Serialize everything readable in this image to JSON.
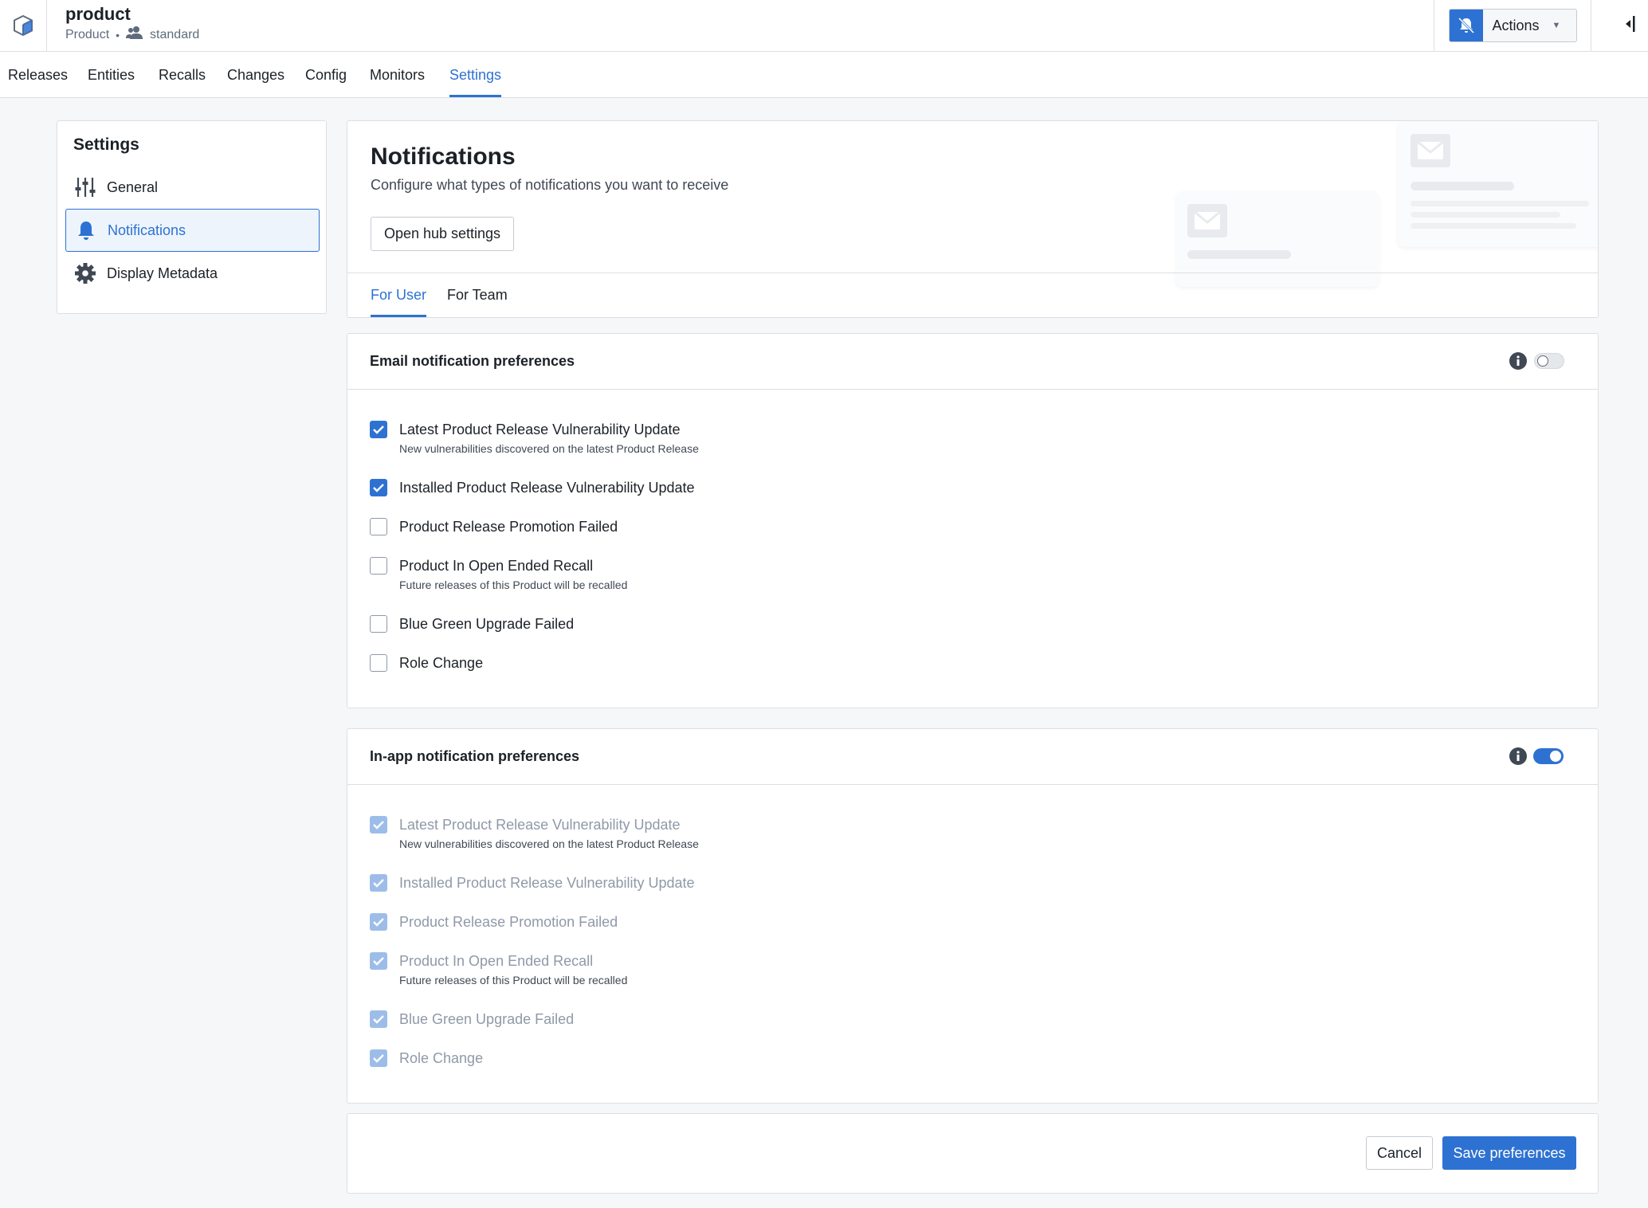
{
  "header": {
    "title": "product",
    "type_label": "Product",
    "separator": "•",
    "role_label": "standard",
    "actions_label": "Actions"
  },
  "tabs": [
    {
      "label": "Releases"
    },
    {
      "label": "Entities"
    },
    {
      "label": "Recalls"
    },
    {
      "label": "Changes"
    },
    {
      "label": "Config"
    },
    {
      "label": "Monitors"
    },
    {
      "label": "Settings",
      "active": true
    }
  ],
  "sidebar": {
    "title": "Settings",
    "items": [
      {
        "label": "General",
        "icon": "sliders-icon"
      },
      {
        "label": "Notifications",
        "icon": "bell-icon",
        "active": true
      },
      {
        "label": "Display Metadata",
        "icon": "gear-icon"
      }
    ]
  },
  "notifications": {
    "title": "Notifications",
    "description": "Configure what types of notifications you want to receive",
    "hub_button": "Open hub settings",
    "sub_tabs": [
      {
        "label": "For User",
        "active": true
      },
      {
        "label": "For Team"
      }
    ]
  },
  "email_prefs": {
    "title": "Email notification preferences",
    "enabled": false,
    "options": [
      {
        "label": "Latest Product Release Vulnerability Update",
        "description": "New vulnerabilities discovered on the latest Product Release",
        "checked": true
      },
      {
        "label": "Installed Product Release Vulnerability Update",
        "checked": true
      },
      {
        "label": "Product Release Promotion Failed",
        "checked": false
      },
      {
        "label": "Product In Open Ended Recall",
        "description": "Future releases of this Product will be recalled",
        "checked": false
      },
      {
        "label": "Blue Green Upgrade Failed",
        "checked": false
      },
      {
        "label": "Role Change",
        "checked": false
      }
    ]
  },
  "inapp_prefs": {
    "title": "In-app notification preferences",
    "enabled": true,
    "options": [
      {
        "label": "Latest Product Release Vulnerability Update",
        "description": "New vulnerabilities discovered on the latest Product Release",
        "checked": true,
        "disabled": true
      },
      {
        "label": "Installed Product Release Vulnerability Update",
        "checked": true,
        "disabled": true
      },
      {
        "label": "Product Release Promotion Failed",
        "checked": true,
        "disabled": true
      },
      {
        "label": "Product In Open Ended Recall",
        "description": "Future releases of this Product will be recalled",
        "checked": true,
        "disabled": true
      },
      {
        "label": "Blue Green Upgrade Failed",
        "checked": true,
        "disabled": true
      },
      {
        "label": "Role Change",
        "checked": true,
        "disabled": true
      }
    ]
  },
  "footer": {
    "cancel_label": "Cancel",
    "save_label": "Save preferences"
  },
  "colors": {
    "accent": "#2d72d2",
    "disabled_check": "#9dbde9"
  }
}
